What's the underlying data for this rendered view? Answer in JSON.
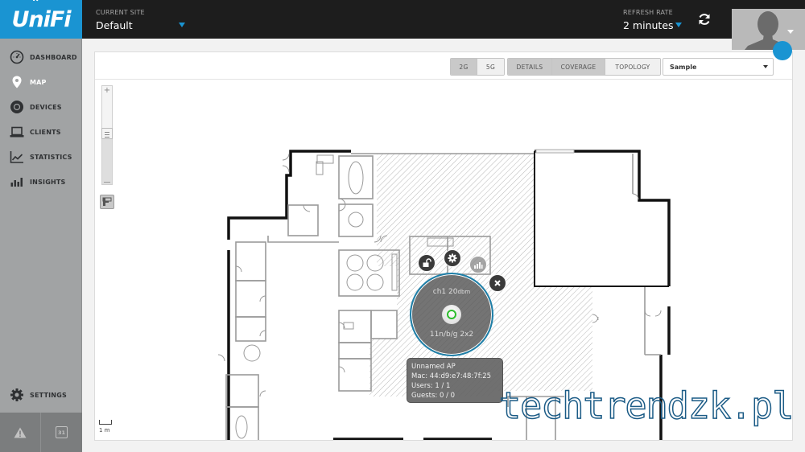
{
  "app": {
    "brand": "UniFi",
    "accent_color": "#1a94d2"
  },
  "header": {
    "site_label": "CURRENT SITE",
    "site_value": "Default",
    "refresh_label": "REFRESH RATE",
    "refresh_value": "2 minutes"
  },
  "sidebar": {
    "items": [
      {
        "label": "DASHBOARD",
        "icon": "dashboard-gauge-icon"
      },
      {
        "label": "MAP",
        "icon": "map-pin-icon",
        "active": true
      },
      {
        "label": "DEVICES",
        "icon": "devices-icon"
      },
      {
        "label": "CLIENTS",
        "icon": "laptop-icon"
      },
      {
        "label": "STATISTICS",
        "icon": "line-chart-icon"
      },
      {
        "label": "INSIGHTS",
        "icon": "bar-chart-icon"
      }
    ],
    "settings_label": "SETTINGS",
    "calendar_day": "31"
  },
  "toolbar": {
    "band_buttons": [
      "2G",
      "5G"
    ],
    "view_buttons": [
      "DETAILS",
      "COVERAGE",
      "TOPOLOGY"
    ],
    "map_select": "Sample"
  },
  "map": {
    "scale_label": "1 m",
    "ap": {
      "channel": "ch1",
      "power": "20",
      "power_unit": "dbm",
      "radio": "11n/b/g",
      "streams": "2x2",
      "status_color": "#2dbe2d"
    },
    "tooltip": {
      "name": "Unnamed AP",
      "mac": "Mac: 44:d9:e7:48:7f:25",
      "users": "Users: 1 / 1",
      "guests": "Guests: 0 / 0"
    }
  },
  "watermark": "techtrendzk.pl"
}
